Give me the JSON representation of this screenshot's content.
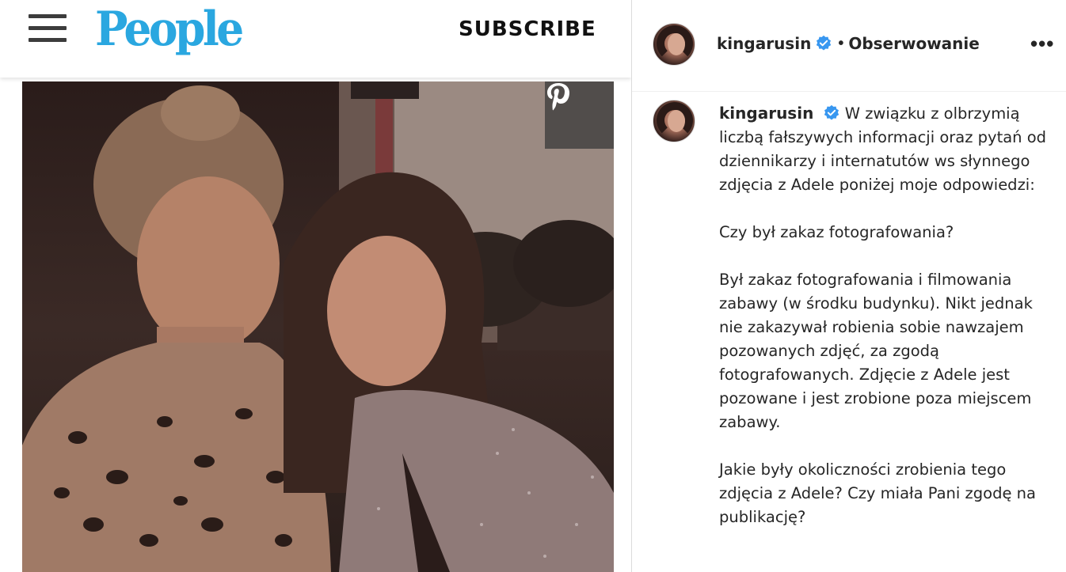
{
  "people": {
    "logo": "People",
    "subscribe_label": "SUBSCRIBE",
    "menu_icon": "hamburger-menu-icon",
    "pin_icon": "pinterest-icon",
    "brand_color": "#2aa7e0"
  },
  "instagram": {
    "username": "kingarusin",
    "separator": "•",
    "follow_label": "Obserwowanie",
    "more_icon": "•••",
    "verified_color": "#3897f0",
    "caption": {
      "username": "kingarusin",
      "paragraphs": [
        "W związku z olbrzymią liczbą fałszywych informacji oraz pytań od dziennikarzy i internatutów ws słynnego zdjęcia z Adele poniżej moje odpowiedzi:",
        "Czy był zakaz fotografowania?",
        "Był zakaz fotografowania i filmowania zabawy (w środku budynku). Nikt jednak nie zakazywał robienia sobie nawzajem pozowanych zdjęć, za zgodą fotografowanych. Zdjęcie z Adele jest pozowane i jest zrobione poza miejscem zabawy.",
        "Jakie były okoliczności zrobienia tego zdjęcia z Adele? Czy miała Pani zgodę na publikację?"
      ]
    }
  }
}
